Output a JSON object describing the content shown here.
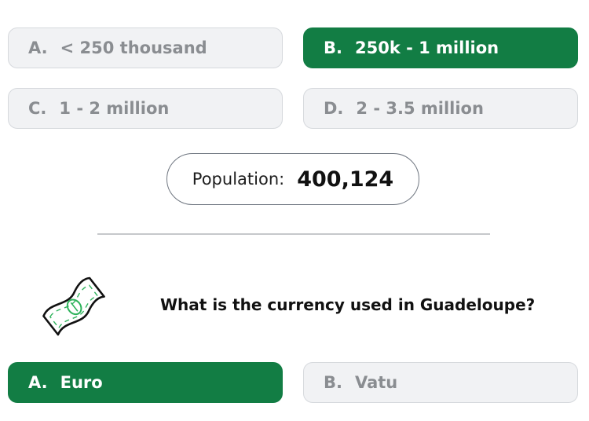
{
  "previous_question": {
    "options": [
      {
        "letter": "A.",
        "text": "< 250 thousand"
      },
      {
        "letter": "B.",
        "text": "250k - 1 million"
      },
      {
        "letter": "C.",
        "text": "1 - 2 million"
      },
      {
        "letter": "D.",
        "text": "2 - 3.5 million"
      }
    ],
    "selected": "B",
    "result": {
      "label": "Population:",
      "value": "400,124"
    }
  },
  "current_question": {
    "icon": "money-bill-icon",
    "text": "What is the currency used in Guadeloupe?",
    "options": [
      {
        "letter": "A.",
        "text": "Euro"
      },
      {
        "letter": "B.",
        "text": "Vatu"
      }
    ],
    "selected": "A"
  },
  "colors": {
    "selected_bg": "#127d44",
    "unselected_bg": "#f1f2f4",
    "unselected_text": "#8a8d91",
    "icon_accent": "#2fb35c"
  }
}
